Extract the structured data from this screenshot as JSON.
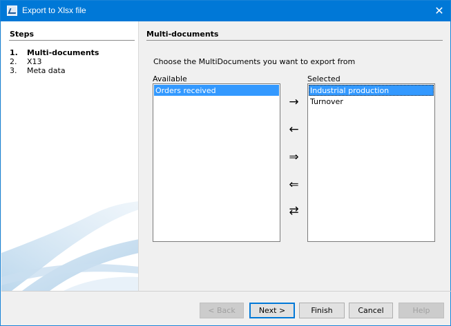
{
  "window": {
    "title": "Export to Xlsx file",
    "close_glyph": "✕"
  },
  "steps": {
    "header": "Steps",
    "items": [
      {
        "num": "1.",
        "label": "Multi-documents",
        "active": true
      },
      {
        "num": "2.",
        "label": "X13",
        "active": false
      },
      {
        "num": "3.",
        "label": "Meta data",
        "active": false
      }
    ]
  },
  "content": {
    "title": "Multi-documents",
    "instruction": "Choose the MultiDocuments you want to export from",
    "available_label": "Available",
    "selected_label": "Selected",
    "available_items": [
      {
        "label": "Orders received",
        "selected": true
      }
    ],
    "selected_items": [
      {
        "label": "Industrial production",
        "selected": true
      },
      {
        "label": "Turnover",
        "selected": false
      }
    ],
    "arrows": {
      "add": "→",
      "remove": "←",
      "add_all": "⇒",
      "remove_all": "⇐",
      "swap": "⇄"
    }
  },
  "buttons": {
    "back": "< Back",
    "next": "Next >",
    "finish": "Finish",
    "cancel": "Cancel",
    "help": "Help"
  },
  "colors": {
    "titlebar": "#0078d7",
    "selection": "#3399ff"
  }
}
